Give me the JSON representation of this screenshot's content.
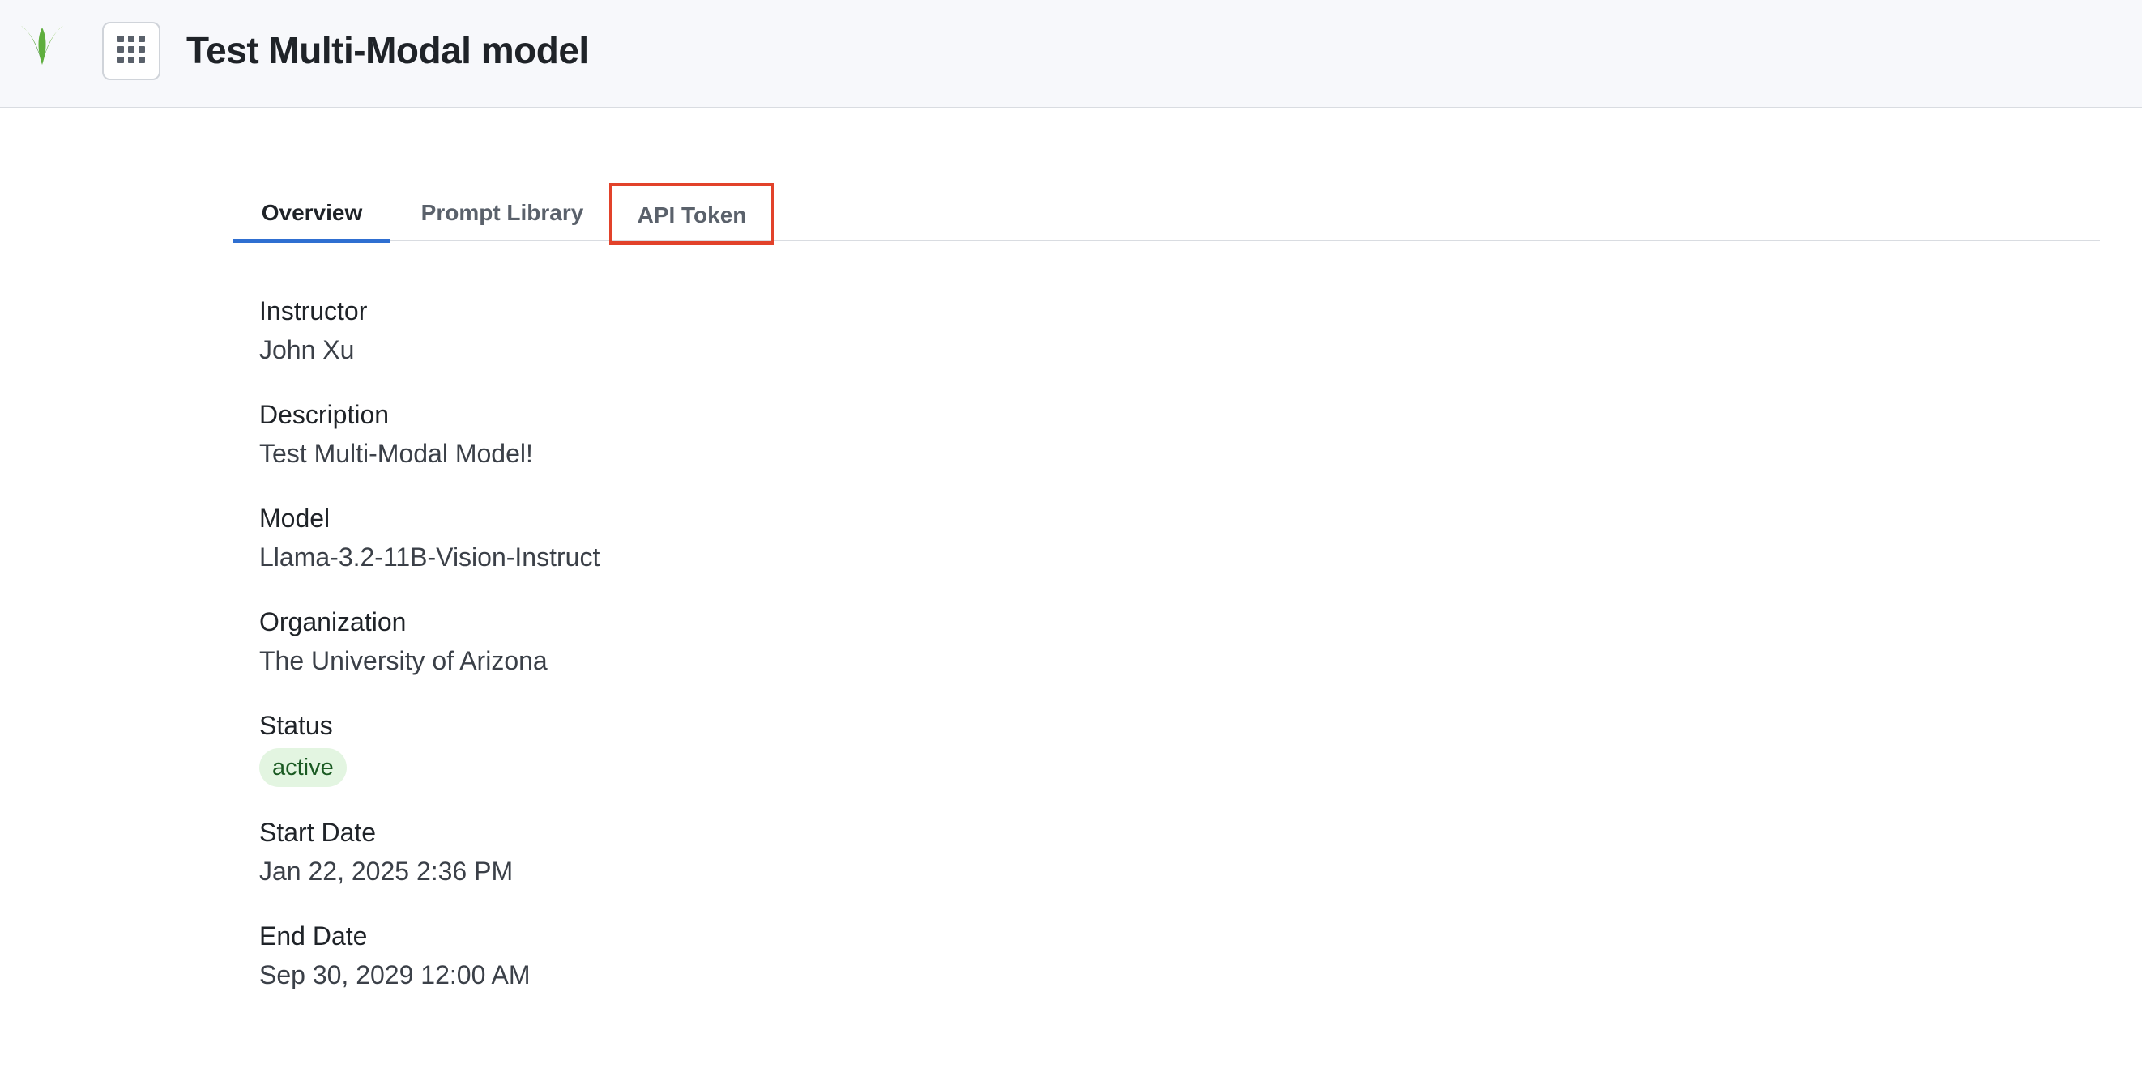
{
  "header": {
    "logo_icon": "v-leaf-logo-icon",
    "apps_icon": "grid-apps-icon",
    "title": "Test Multi-Modal model"
  },
  "tabs": [
    {
      "label": "Overview",
      "active": true
    },
    {
      "label": "Prompt Library",
      "active": false
    },
    {
      "label": "API Token",
      "active": false,
      "highlighted": true
    }
  ],
  "details": {
    "instructor": {
      "label": "Instructor",
      "value": "John Xu"
    },
    "description": {
      "label": "Description",
      "value": "Test Multi-Modal Model!"
    },
    "model": {
      "label": "Model",
      "value": "Llama-3.2-11B-Vision-Instruct"
    },
    "organization": {
      "label": "Organization",
      "value": "The University of Arizona"
    },
    "status": {
      "label": "Status",
      "value": "active"
    },
    "start_date": {
      "label": "Start Date",
      "value": "Jan 22, 2025 2:36 PM"
    },
    "end_date": {
      "label": "End Date",
      "value": "Sep 30, 2029 12:00 AM"
    }
  },
  "colors": {
    "active_tab_underline": "#2f6fd1",
    "highlight_box": "#e2422a",
    "status_badge_bg": "#e3f5e1",
    "status_badge_text": "#1a5a22",
    "header_bg": "#f7f8fb"
  }
}
